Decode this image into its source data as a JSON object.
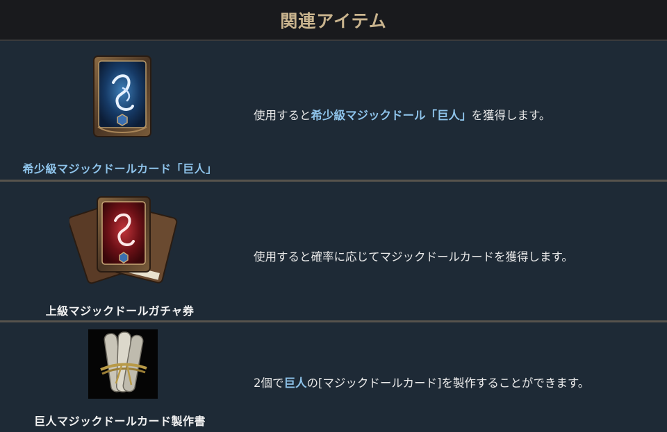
{
  "header": {
    "title": "関連アイテム"
  },
  "items": [
    {
      "name": "希少級マジックドールカード「巨人」",
      "icon": "blue-magic-doll-card-icon",
      "desc_pre": "使用すると",
      "desc_hl": "希少級マジックドール「巨人」",
      "desc_post": "を獲得します。"
    },
    {
      "name": "上級マジックドールガチャ券",
      "icon": "red-card-stack-icon",
      "desc": "使用すると確率に応じてマジックドールカードを獲得します。"
    },
    {
      "name": "巨人マジックドールカード製作書",
      "icon": "scroll-bundle-icon",
      "desc_pre": "2個で",
      "desc_hl": "巨人",
      "desc_post": "の[マジックドールカード]を製作することができます。"
    }
  ],
  "colors": {
    "header_bg": "#191a1d",
    "header_text": "#c9b48e",
    "panel_bg": "#1e2a36",
    "highlight": "#8ec3ea",
    "separator": "#57534d"
  }
}
